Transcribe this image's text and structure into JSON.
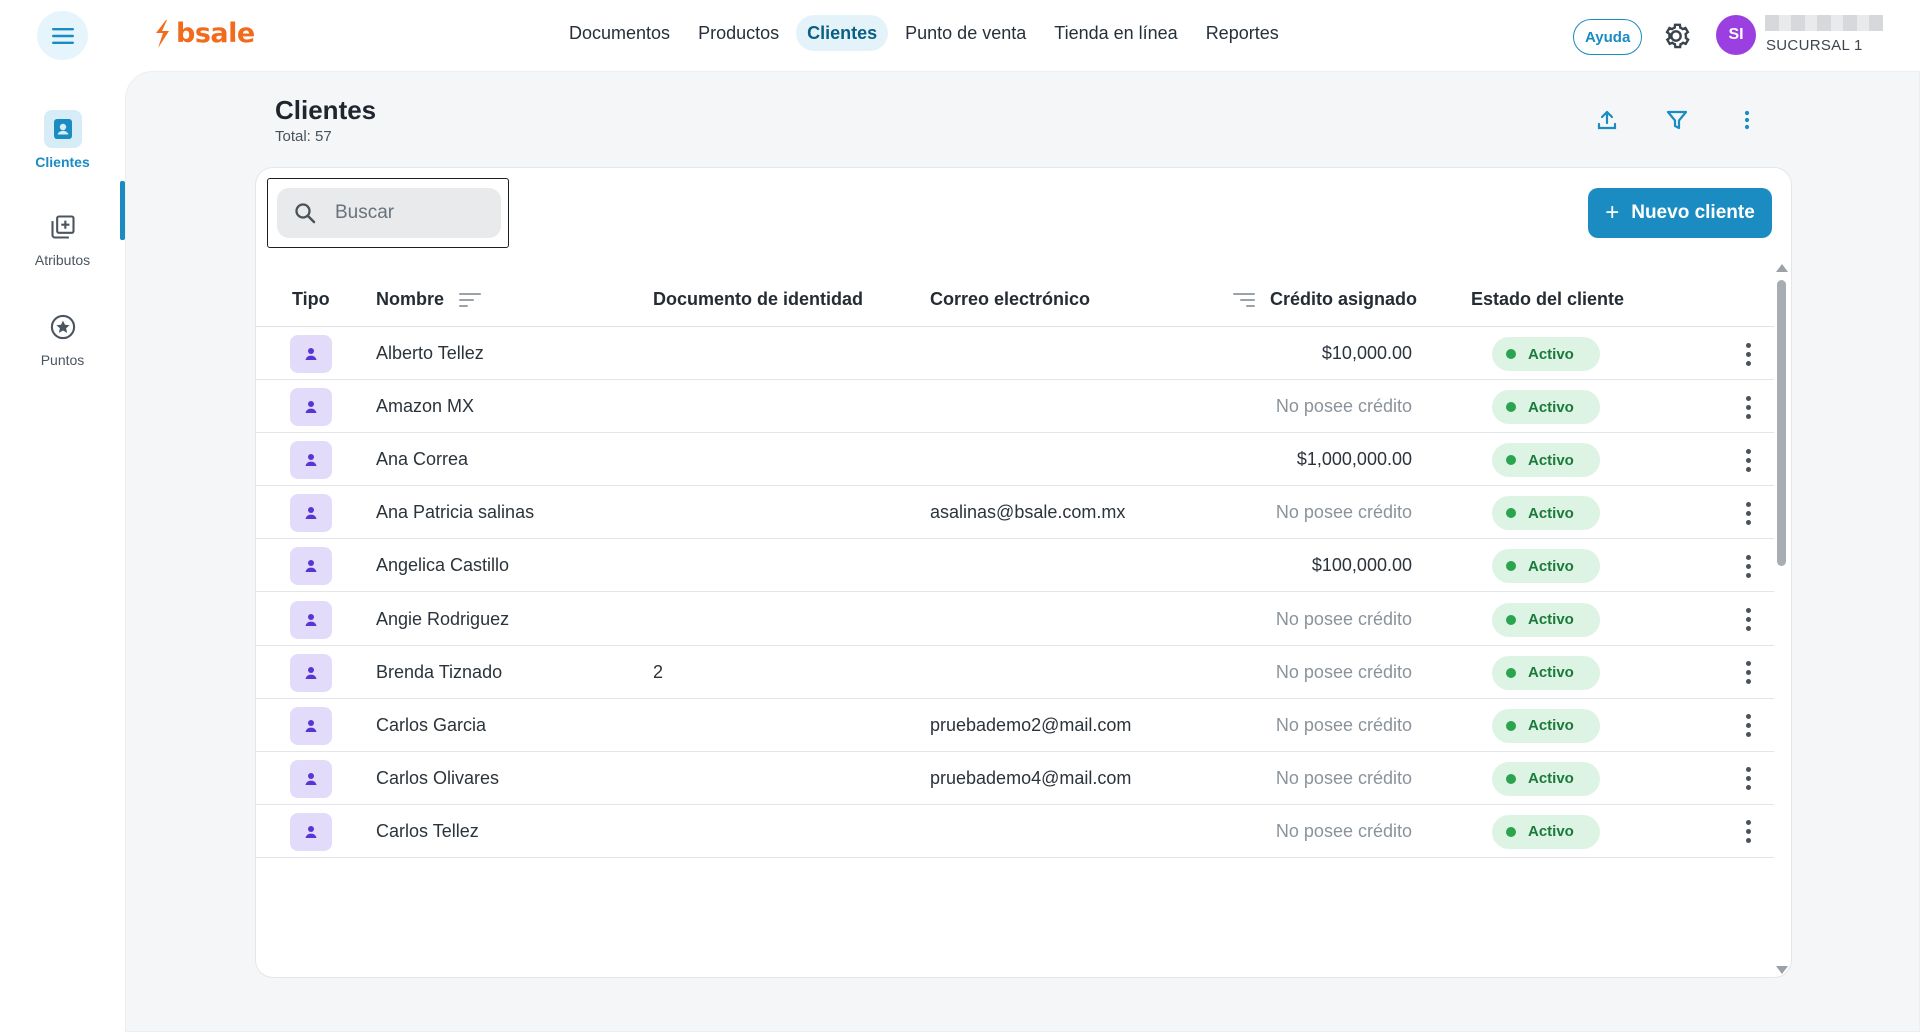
{
  "app": {
    "brand": "bsale",
    "brand_color": "#f26b1d",
    "accent": "#1a8cc2"
  },
  "nav": {
    "items": [
      {
        "label": "Documentos",
        "active": false
      },
      {
        "label": "Productos",
        "active": false
      },
      {
        "label": "Clientes",
        "active": true
      },
      {
        "label": "Punto de venta",
        "active": false
      },
      {
        "label": "Tienda en línea",
        "active": false
      },
      {
        "label": "Reportes",
        "active": false
      }
    ]
  },
  "header": {
    "help_label": "Ayuda",
    "avatar_initials": "SI",
    "branch": "SUCURSAL 1"
  },
  "rail": {
    "items": [
      {
        "label": "Clientes",
        "icon": "contact-card-icon",
        "active": true
      },
      {
        "label": "Atributos",
        "icon": "library-add-icon",
        "active": false
      },
      {
        "label": "Puntos",
        "icon": "star-circle-icon",
        "active": false
      }
    ]
  },
  "page": {
    "title": "Clientes",
    "total": "Total: 57"
  },
  "toolbar": {
    "search_placeholder": "Buscar",
    "new_label": "Nuevo cliente"
  },
  "table": {
    "columns": {
      "tipo": "Tipo",
      "nombre": "Nombre",
      "documento": "Documento de identidad",
      "correo": "Correo electrónico",
      "credito": "Crédito asignado",
      "estado": "Estado del cliente"
    },
    "rows": [
      {
        "nombre": "Alberto Tellez",
        "documento": "",
        "correo": "",
        "credito": "$10,000.00",
        "has_credit": true,
        "estado": "Activo"
      },
      {
        "nombre": "Amazon MX",
        "documento": "",
        "correo": "",
        "credito": "No posee crédito",
        "has_credit": false,
        "estado": "Activo"
      },
      {
        "nombre": "Ana Correa",
        "documento": "",
        "correo": "",
        "credito": "$1,000,000.00",
        "has_credit": true,
        "estado": "Activo"
      },
      {
        "nombre": "Ana Patricia salinas",
        "documento": "",
        "correo": "asalinas@bsale.com.mx",
        "credito": "No posee crédito",
        "has_credit": false,
        "estado": "Activo"
      },
      {
        "nombre": "Angelica Castillo",
        "documento": "",
        "correo": "",
        "credito": "$100,000.00",
        "has_credit": true,
        "estado": "Activo"
      },
      {
        "nombre": "Angie Rodriguez",
        "documento": "",
        "correo": "",
        "credito": "No posee crédito",
        "has_credit": false,
        "estado": "Activo"
      },
      {
        "nombre": "Brenda Tiznado",
        "documento": "2",
        "correo": "",
        "credito": "No posee crédito",
        "has_credit": false,
        "estado": "Activo"
      },
      {
        "nombre": "Carlos Garcia",
        "documento": "",
        "correo": "pruebademo2@mail.com",
        "credito": "No posee crédito",
        "has_credit": false,
        "estado": "Activo"
      },
      {
        "nombre": "Carlos Olivares",
        "documento": "",
        "correo": "pruebademo4@mail.com",
        "credito": "No posee crédito",
        "has_credit": false,
        "estado": "Activo"
      },
      {
        "nombre": "Carlos Tellez",
        "documento": "",
        "correo": "",
        "credito": "No posee crédito",
        "has_credit": false,
        "estado": "Activo"
      }
    ]
  }
}
